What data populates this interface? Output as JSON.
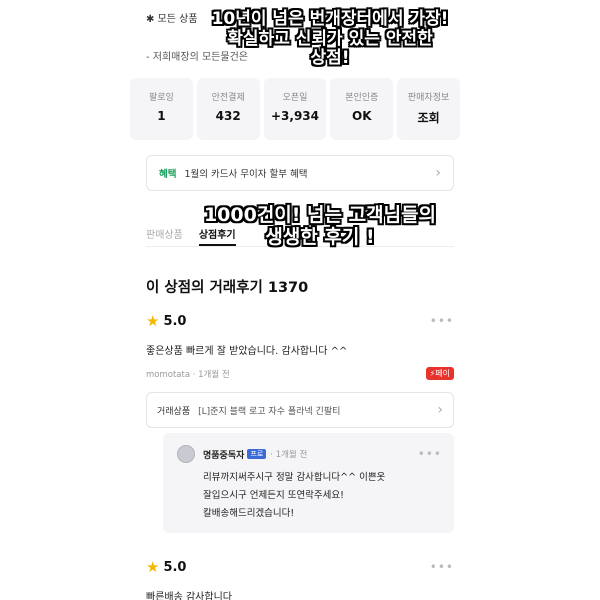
{
  "notes": {
    "line1": "✱ 모든 상품",
    "line2": "- 저희매장의 모든물건은"
  },
  "stats": [
    {
      "label": "팔로잉",
      "value": "1"
    },
    {
      "label": "안전결제",
      "value": "432"
    },
    {
      "label": "오픈일",
      "value": "+3,934"
    },
    {
      "label": "본인인증",
      "value": "OK"
    },
    {
      "label": "판매자정보",
      "value": "조회"
    }
  ],
  "benefit": {
    "tag": "혜택",
    "text": "1월의 카드사 무이자 할부 혜택"
  },
  "tabs": [
    {
      "label": "판매상품"
    },
    {
      "label": "상점후기"
    }
  ],
  "section_title": "이 상점의 거래후기 1370",
  "review1": {
    "rating": "5.0",
    "text": "좋은상품 빠르게 잘 받았습니다. 감사합니다 ^^",
    "meta": "momotata · 1개월 전",
    "pay_badge": "⚡페이",
    "product_label": "거래상품",
    "product_name": "[L]준지 블랙 로고 자수 폴라넥 긴팔티"
  },
  "reply": {
    "name": "명품중독자",
    "badge": "프로",
    "time": "· 1개월 전",
    "lines": [
      "리뷰까지써주시구 정말 감사합니다^^ 이쁜옷",
      "잘입으시구 언제든지 또연락주세요!",
      "칼배송해드리겠습니다!"
    ]
  },
  "review2": {
    "rating": "5.0",
    "text": "빠른배송 감사합니다"
  },
  "overlays": {
    "top": [
      "10년이 넘은 번개장터에서 가장!",
      "확실하고 신뢰가 있는 안전한",
      "상점!"
    ],
    "middle": [
      "1000건이! 넘는 고객님들의",
      "생생한 후기 !"
    ]
  },
  "icons": {
    "star": "★",
    "more": "•••",
    "chevron": "›"
  },
  "colors": {
    "star": "#f5b800",
    "benefit_tag": "#1aa05b",
    "pay_badge": "#e8322c",
    "pro_badge": "#3b6bd9"
  }
}
